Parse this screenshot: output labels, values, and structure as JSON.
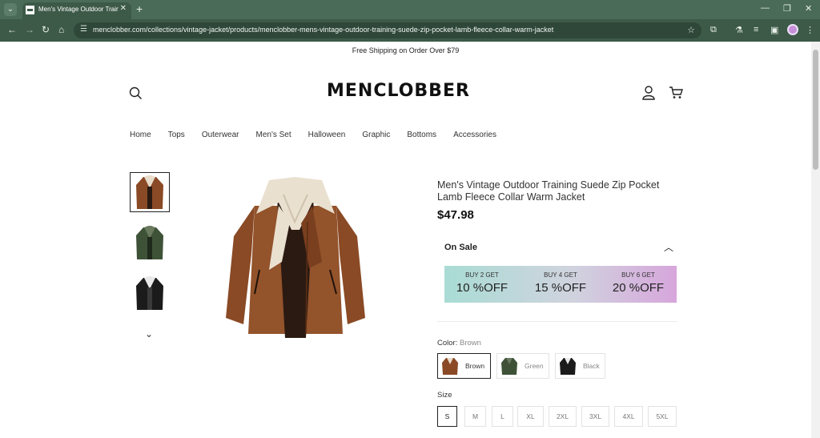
{
  "browser": {
    "tab_title": "Men's Vintage Outdoor Traini",
    "url": "menclobber.com/collections/vintage-jacket/products/menclobber-mens-vintage-outdoor-training-suede-zip-pocket-lamb-fleece-collar-warm-jacket"
  },
  "announcement": "Free Shipping on Order Over $79",
  "header": {
    "logo": "MENCLOBBER"
  },
  "nav": [
    "Home",
    "Tops",
    "Outerwear",
    "Men's Set",
    "Halloween",
    "Graphic",
    "Bottoms",
    "Accessories"
  ],
  "product": {
    "title": "Men's Vintage Outdoor Training Suede Zip Pocket Lamb Fleece Collar Warm Jacket",
    "price": "$47.98",
    "on_sale_label": "On Sale",
    "promos": [
      {
        "small": "BUY 2 GET",
        "big": "10 %OFF"
      },
      {
        "small": "BUY 4 GET",
        "big": "15 %OFF"
      },
      {
        "small": "BUY 6 GET",
        "big": "20 %OFF"
      }
    ],
    "color_label": "Color:",
    "color_value": "Brown",
    "colors": [
      "Brown",
      "Green",
      "Black"
    ],
    "size_label": "Size",
    "sizes": [
      "S",
      "M",
      "L",
      "XL",
      "2XL",
      "3XL",
      "4XL",
      "5XL"
    ],
    "selected_size": "S"
  },
  "colors": {
    "chrome_tabbar": "#4a6b57",
    "chrome_toolbar": "#3d5a48",
    "jacket_brown": "#8a4a25",
    "jacket_green": "#3e5238",
    "jacket_black": "#1b1b1b"
  }
}
